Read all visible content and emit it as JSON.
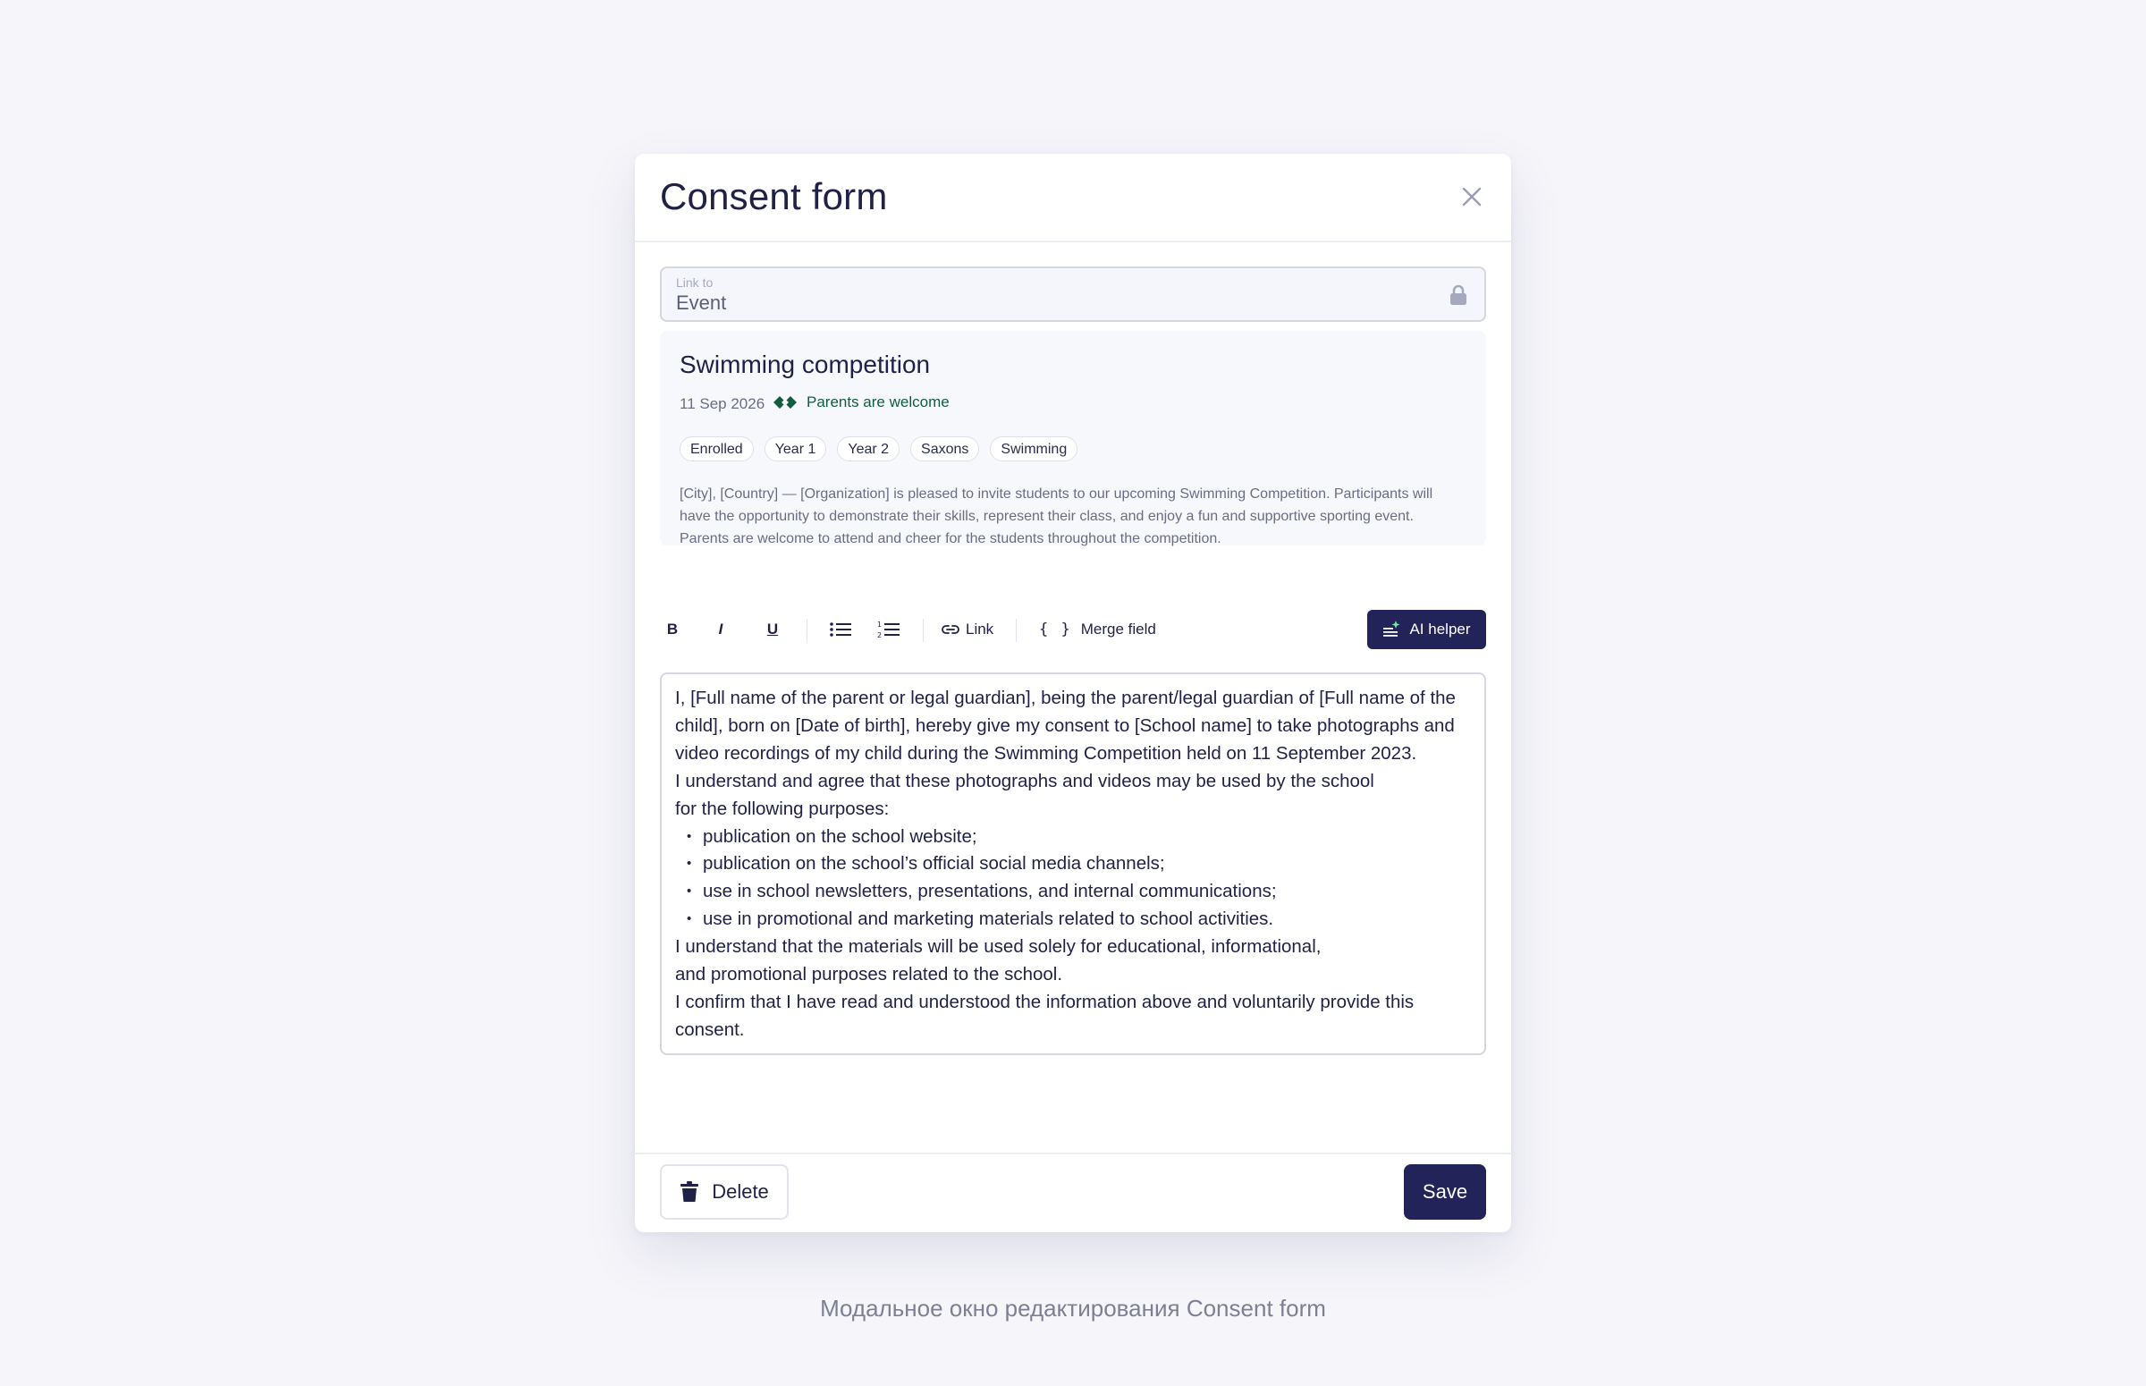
{
  "modal": {
    "title": "Consent form",
    "link_field": {
      "label": "Link to",
      "value": "Event"
    },
    "event": {
      "title": "Swimming competition",
      "date": "11 Sep 2026",
      "badge": "Parents are welcome",
      "tags": [
        "Enrolled",
        "Year 1",
        "Year 2",
        "Saxons",
        "Swimming"
      ],
      "description": "[City], [Country] — [Organization] is pleased to invite students to our upcoming Swimming Competition. Participants will have the opportunity to demonstrate their skills, represent their class, and enjoy a fun and supportive sporting event. Parents are welcome to attend and cheer for the students throughout the competition."
    },
    "toolbar": {
      "bold": "B",
      "italic": "I",
      "underline": "U",
      "link": "Link",
      "merge_field": "Merge field",
      "ai_helper": "AI helper"
    },
    "editor": {
      "para1": "I, [Full name of the parent or legal guardian], being the parent/legal guardian of [Full name of the child], born on [Date of birth], hereby give my consent to [School name] to take photographs and video recordings of my child during the Swimming Competition held on 11 September 2023.",
      "para2_line1": "I understand and agree that these photographs and videos may be used by the school",
      "para2_line2": "for the following purposes:",
      "bullets": [
        "publication on the school website;",
        "publication on the school’s official social media channels;",
        "use in school newsletters, presentations, and internal communications;",
        "use in promotional and marketing materials related to school activities."
      ],
      "para3_line1": "I understand that the materials will be used solely for educational, informational,",
      "para3_line2": "and promotional purposes related to the school.",
      "para4": "I confirm that I have read and understood the information above and voluntarily provide this consent."
    },
    "footer": {
      "delete": "Delete",
      "save": "Save"
    }
  },
  "caption": "Модальное окно редактирования Consent form",
  "colors": {
    "primary": "#222459",
    "badge_green": "#135d3f",
    "page_bg": "#f5f5fa"
  }
}
